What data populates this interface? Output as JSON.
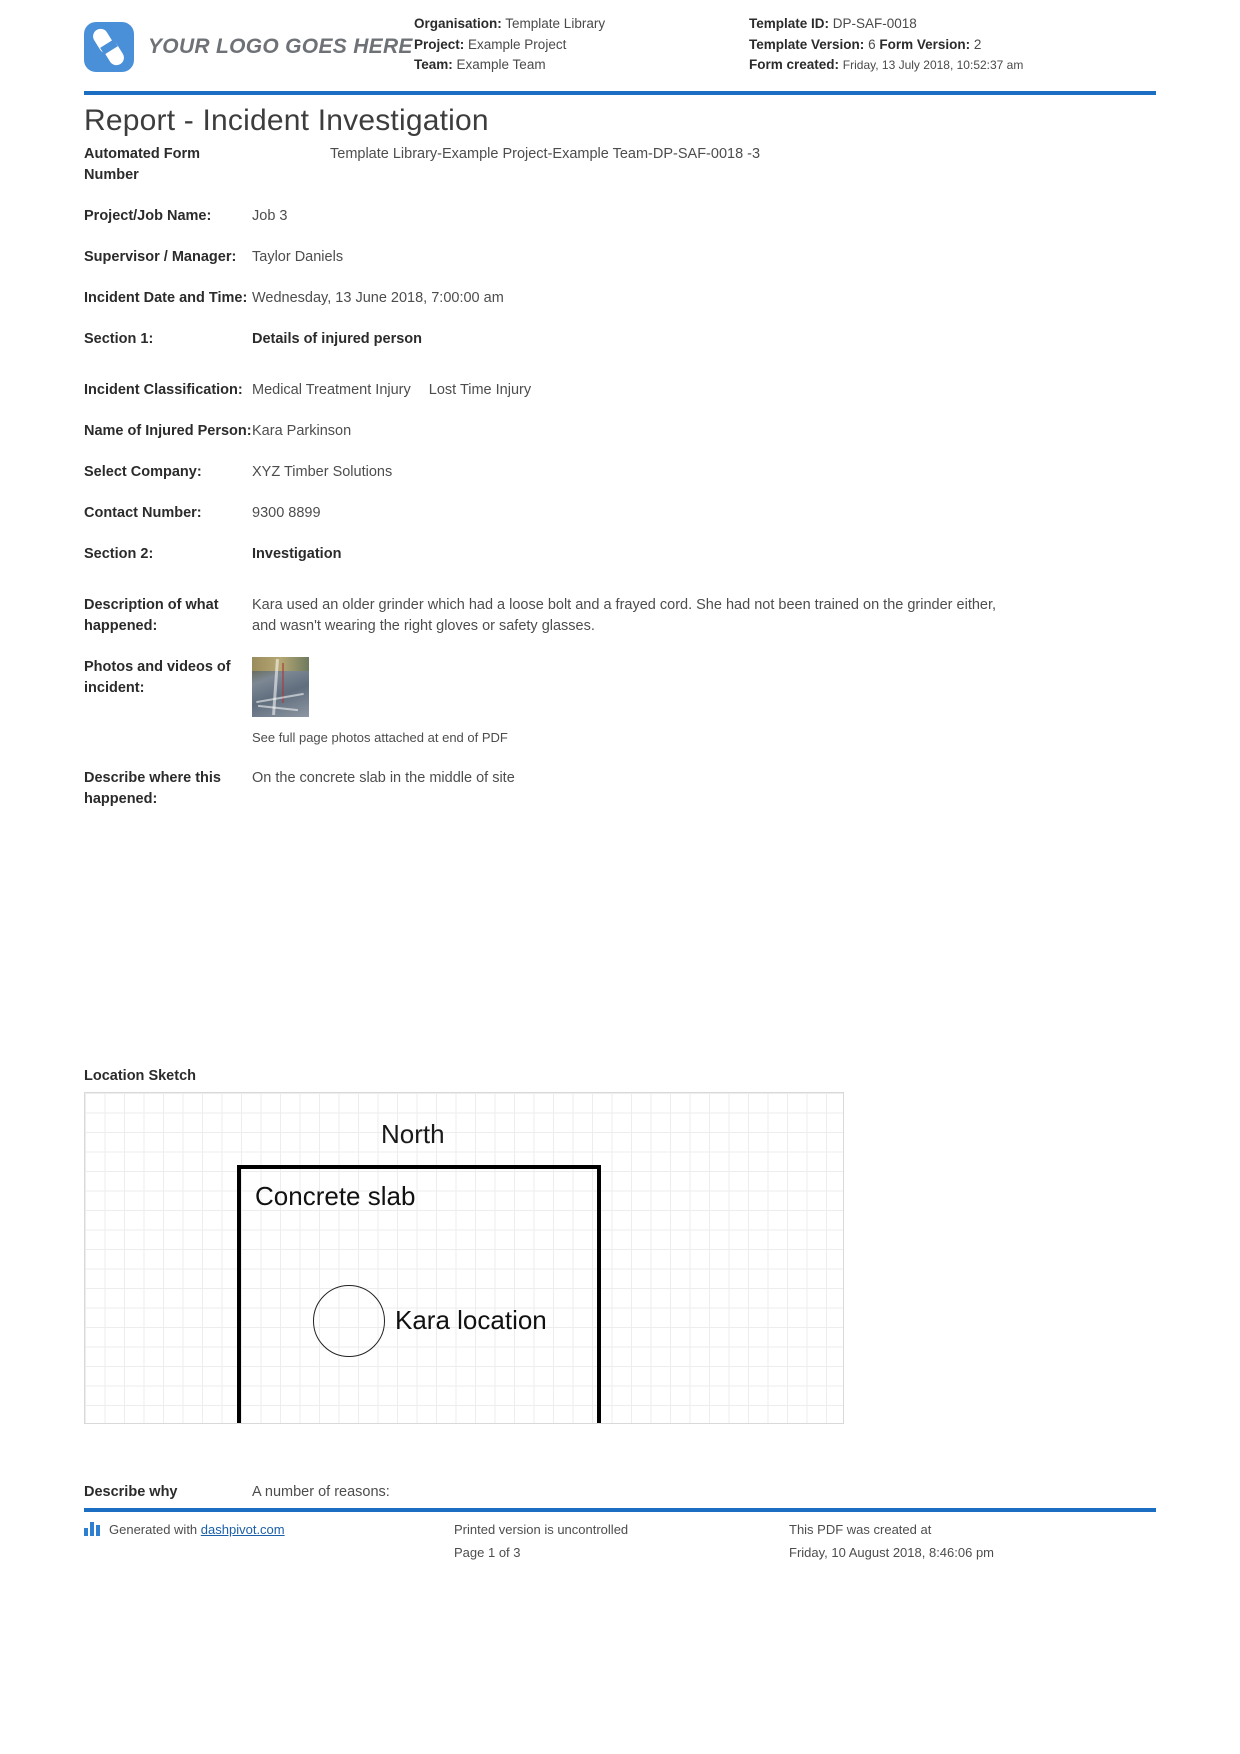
{
  "header": {
    "logo_text": "YOUR LOGO GOES HERE",
    "left_meta": [
      {
        "key": "Organisation:",
        "value": "Template Library"
      },
      {
        "key": "Project:",
        "value": "Example Project"
      },
      {
        "key": "Team:",
        "value": "Example Team"
      }
    ],
    "right_meta": {
      "template_id_key": "Template ID:",
      "template_id_value": "DP-SAF-0018",
      "template_version_key": "Template Version:",
      "template_version_value": "6",
      "form_version_key": "Form Version:",
      "form_version_value": "2",
      "form_created_key": "Form created:",
      "form_created_value": "Friday, 13 July 2018, 10:52:37 am"
    }
  },
  "title": "Report - Incident Investigation",
  "fields": {
    "automated_form_number_label": "Automated Form Number",
    "automated_form_number_value": "Template Library-Example Project-Example Team-DP-SAF-0018   -3",
    "project_job_name_label": "Project/Job Name:",
    "project_job_name_value": "Job 3",
    "supervisor_label": "Supervisor / Manager:",
    "supervisor_value": "Taylor Daniels",
    "incident_datetime_label": "Incident Date and Time:",
    "incident_datetime_value": "Wednesday, 13 June 2018, 7:00:00 am",
    "section1_label": "Section 1:",
    "section1_value": "Details of injured person",
    "incident_classification_label": "Incident Classification:",
    "incident_classification_values": [
      "Medical Treatment Injury",
      "Lost Time Injury"
    ],
    "injured_person_label": "Name of Injured Person:",
    "injured_person_value": "Kara Parkinson",
    "select_company_label": "Select Company:",
    "select_company_value": "XYZ Timber Solutions",
    "contact_number_label": "Contact Number:",
    "contact_number_value": "9300 8899",
    "section2_label": "Section 2:",
    "section2_value": "Investigation",
    "description_label": "Description of what happened:",
    "description_value": "Kara used an older grinder which had a loose bolt and a frayed cord. She had not been trained on the grinder either, and wasn't wearing the right gloves or safety glasses.",
    "photos_label": "Photos and videos of incident:",
    "photos_caption": "See full page photos attached at end of PDF",
    "where_label": "Describe where this happened:",
    "where_value": "On the concrete slab in the middle of site",
    "describe_why_label": "Describe why",
    "describe_why_value": "A number of reasons:"
  },
  "sketch": {
    "heading": "Location Sketch",
    "north": "North",
    "slab": "Concrete slab",
    "kara": "Kara location"
  },
  "footer": {
    "generated_prefix": "Generated with",
    "generated_link": "dashpivot.com",
    "printed_line1": "Printed version is uncontrolled",
    "printed_line2": "Page 1 of 3",
    "created_line1": "This PDF was created at",
    "created_line2": "Friday, 10 August 2018, 8:46:06 pm"
  },
  "colors": {
    "accent": "#1b6ec2",
    "logo": "#4a90d9",
    "link": "#1b5fa8"
  }
}
